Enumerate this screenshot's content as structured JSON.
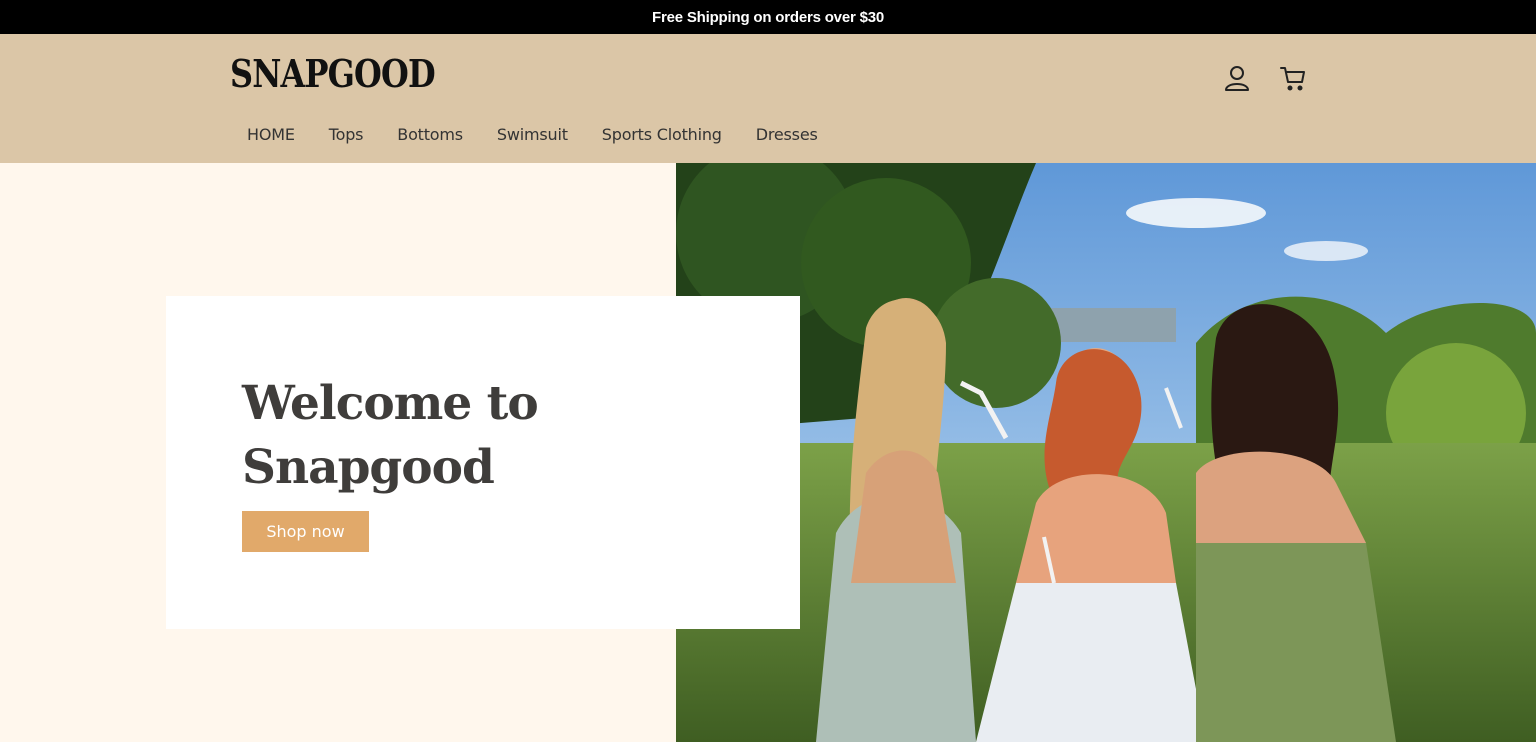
{
  "announcement": {
    "text": "Free Shipping on orders over $30"
  },
  "header": {
    "logo": "SNAPGOOD",
    "icons": {
      "account": "user-icon",
      "cart": "cart-icon"
    },
    "nav": [
      {
        "label": "HOME"
      },
      {
        "label": "Tops"
      },
      {
        "label": "Bottoms"
      },
      {
        "label": "Swimsuit"
      },
      {
        "label": "Sports Clothing"
      },
      {
        "label": "Dresses"
      }
    ]
  },
  "hero": {
    "title_line1": "Welcome to",
    "title_line2": "Snapgood",
    "button_label": "Shop now",
    "image": "three women laughing outdoors with glasses"
  },
  "colors": {
    "announcement_bg": "#000000",
    "header_bg": "#dbc6a7",
    "hero_bg": "#fff7ed",
    "button_bg": "#e1a96a"
  }
}
